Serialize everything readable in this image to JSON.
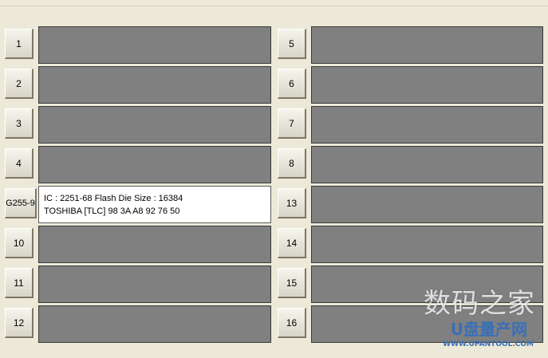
{
  "left_ports": [
    {
      "label": "1"
    },
    {
      "label": "2"
    },
    {
      "label": "3"
    },
    {
      "label": "4"
    },
    {
      "label": "G255-9",
      "info_line1": "IC : 2251-68  Flash Die Size : 16384",
      "info_line2": "TOSHIBA [TLC] 98 3A A8 92 76 50"
    },
    {
      "label": "10"
    },
    {
      "label": "11"
    },
    {
      "label": "12"
    }
  ],
  "right_ports": [
    {
      "label": "5"
    },
    {
      "label": "6"
    },
    {
      "label": "7"
    },
    {
      "label": "8"
    },
    {
      "label": "13"
    },
    {
      "label": "14"
    },
    {
      "label": "15"
    },
    {
      "label": "16"
    }
  ],
  "watermark": {
    "site_name_cn": "数码之家",
    "logo_text": "U盘量产网",
    "url_pre": "WWW.UPANTOOL",
    "url_dot": ".",
    "url_post": "COM"
  },
  "colors": {
    "empty_panel": "#808080",
    "info_panel": "#ffffff",
    "background": "#ece9d8"
  }
}
